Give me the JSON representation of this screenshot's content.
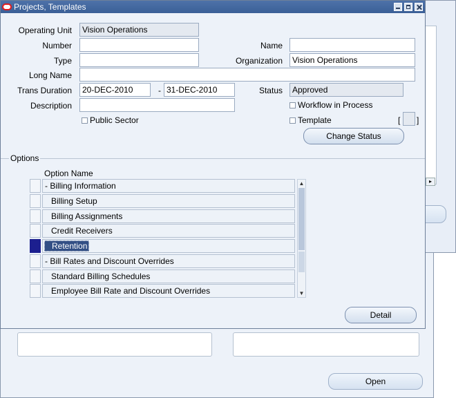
{
  "window": {
    "title": "Projects, Templates"
  },
  "form": {
    "operating_unit_label": "Operating Unit",
    "operating_unit_value": "Vision Operations",
    "number_label": "Number",
    "number_value": "",
    "name_label": "Name",
    "name_value": "",
    "type_label": "Type",
    "type_value": "",
    "organization_label": "Organization",
    "organization_value": "Vision Operations",
    "long_name_label": "Long Name",
    "long_name_value": "",
    "trans_duration_label": "Trans Duration",
    "trans_start": "20-DEC-2010",
    "trans_sep": "-",
    "trans_end": "31-DEC-2010",
    "status_label": "Status",
    "status_value": "Approved",
    "description_label": "Description",
    "description_value": "",
    "workflow_label": "Workflow in Process",
    "public_sector_label": "Public Sector",
    "template_label": "Template",
    "change_status_label": "Change Status",
    "bracket_left": "[",
    "bracket_right": "]"
  },
  "options": {
    "section_label": "Options",
    "column_header": "Option Name",
    "rows": [
      {
        "label": "- Billing Information",
        "selected": false
      },
      {
        "label": "Billing Setup",
        "selected": false
      },
      {
        "label": "Billing Assignments",
        "selected": false
      },
      {
        "label": "Credit Receivers",
        "selected": false
      },
      {
        "label": "Retention",
        "selected": true
      },
      {
        "label": "- Bill Rates and Discount Overrides",
        "selected": false
      },
      {
        "label": "Standard Billing Schedules",
        "selected": false
      },
      {
        "label": "Employee Bill Rate and Discount Overrides",
        "selected": false
      }
    ],
    "detail_label": "Detail"
  },
  "background": {
    "open_label": "Open"
  }
}
